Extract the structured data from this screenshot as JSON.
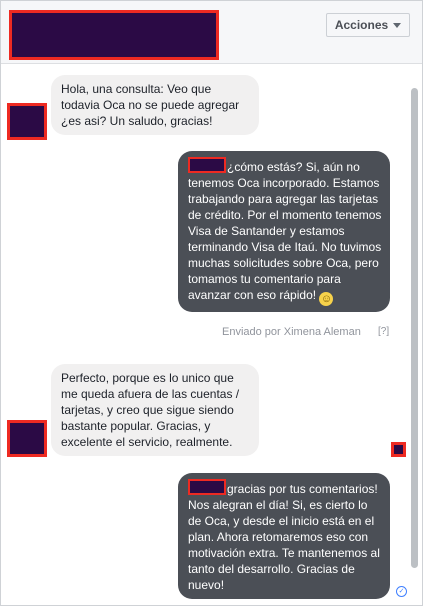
{
  "header": {
    "actions_label": "Acciones"
  },
  "messages": {
    "m1": "Hola, una consulta: Veo que todavia Oca no se puede agregar ¿es asi? Un saludo, gracias!",
    "m2": "¿cómo estás? Si, aún no tenemos Oca incorporado. Estamos trabajando para agregar las tarjetas de crédito. Por el momento tenemos Visa de Santander y estamos terminando Visa de Itaú. No tuvimos muchas solicitudes sobre Oca, pero tomamos tu comentario para avanzar con eso rápido!",
    "m3": "Perfecto, porque es lo unico que me queda afuera de las cuentas / tarjetas, y creo que sigue siendo bastante popular. Gracias, y excelente el servicio, realmente.",
    "m4": "gracias por tus comentarios! Nos alegran el día! Si, es cierto lo de Oca, y desde el inicio está en el plan. Ahora retomaremos eso con motivación extra. Te mantenemos al tanto del desarrollo. Gracias de nuevo!"
  },
  "sent_by": "Enviado por Ximena Aleman",
  "help_link": "[?]",
  "icons": {
    "dropdown": "chevron-down-icon",
    "emoji": "smile-emoji-icon",
    "seen": "seen-check-icon"
  },
  "colors": {
    "redaction_fill": "#2b0a45",
    "redaction_border": "#ee2a22",
    "outgoing_bubble": "#4b4f56",
    "incoming_bubble": "#f1f0f0"
  }
}
